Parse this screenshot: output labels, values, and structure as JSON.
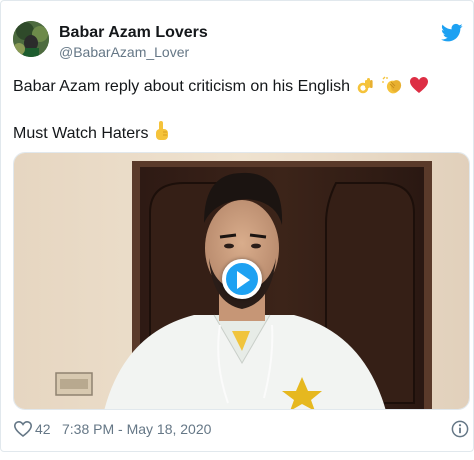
{
  "tweet": {
    "author": {
      "display_name": "Babar Azam Lovers",
      "handle": "@BabarAzam_Lover"
    },
    "text_line_1": "Babar Azam reply about criticism on his English",
    "text_line_2": "Must Watch Haters",
    "emojis_line_1": [
      "ok-hand-icon",
      "clapping-hands-icon",
      "red-heart-icon"
    ],
    "emojis_line_2": [
      "index-pointing-up-icon"
    ],
    "like_count": "42",
    "timestamp": "7:38 PM - May 18, 2020"
  },
  "colors": {
    "brand_blue": "#1da1f2",
    "text_primary": "#14171a",
    "text_secondary": "#657786",
    "heart_red": "#dd2e44",
    "emoji_yellow": "#f5c33b"
  },
  "icons": {
    "brand": "twitter-bird-icon",
    "like": "heart-outline-icon",
    "info": "info-circle-icon",
    "play": "play-icon"
  }
}
